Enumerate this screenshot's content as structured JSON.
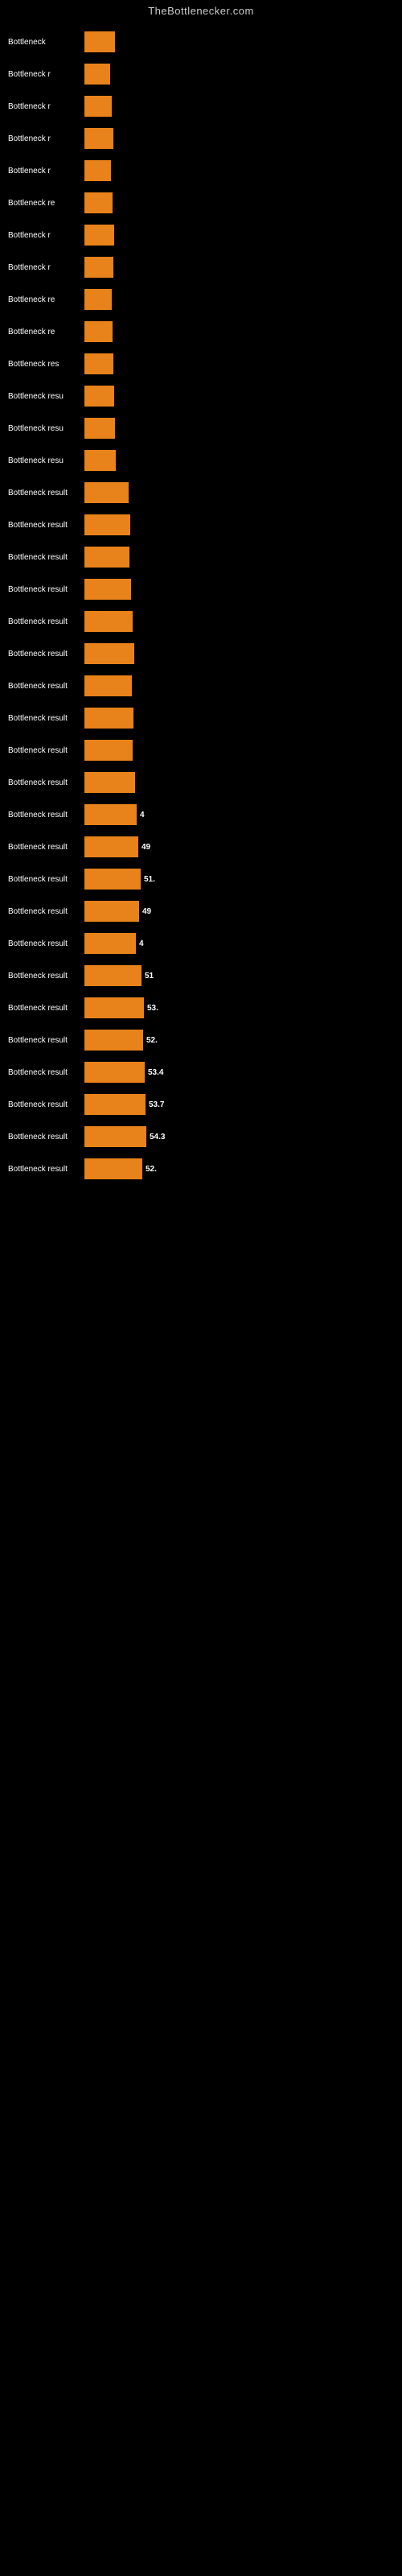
{
  "site": {
    "title": "TheBottlenecker.com"
  },
  "bars": [
    {
      "label": "Bottleneck",
      "width": 38,
      "value": "",
      "outside": false
    },
    {
      "label": "Bottleneck r",
      "width": 32,
      "value": "",
      "outside": false
    },
    {
      "label": "Bottleneck r",
      "width": 34,
      "value": "",
      "outside": false
    },
    {
      "label": "Bottleneck r",
      "width": 36,
      "value": "",
      "outside": false
    },
    {
      "label": "Bottleneck r",
      "width": 33,
      "value": "",
      "outside": false
    },
    {
      "label": "Bottleneck re",
      "width": 35,
      "value": "",
      "outside": false
    },
    {
      "label": "Bottleneck r",
      "width": 37,
      "value": "",
      "outside": false
    },
    {
      "label": "Bottleneck r",
      "width": 36,
      "value": "",
      "outside": false
    },
    {
      "label": "Bottleneck re",
      "width": 34,
      "value": "",
      "outside": false
    },
    {
      "label": "Bottleneck re",
      "width": 35,
      "value": "",
      "outside": false
    },
    {
      "label": "Bottleneck res",
      "width": 36,
      "value": "",
      "outside": false
    },
    {
      "label": "Bottleneck resu",
      "width": 37,
      "value": "",
      "outside": false
    },
    {
      "label": "Bottleneck resu",
      "width": 38,
      "value": "",
      "outside": false
    },
    {
      "label": "Bottleneck resu",
      "width": 39,
      "value": "",
      "outside": false
    },
    {
      "label": "Bottleneck result",
      "width": 55,
      "value": "",
      "outside": false
    },
    {
      "label": "Bottleneck result",
      "width": 57,
      "value": "",
      "outside": false
    },
    {
      "label": "Bottleneck result",
      "width": 56,
      "value": "",
      "outside": false
    },
    {
      "label": "Bottleneck result",
      "width": 58,
      "value": "",
      "outside": false
    },
    {
      "label": "Bottleneck result",
      "width": 60,
      "value": "",
      "outside": false
    },
    {
      "label": "Bottleneck result",
      "width": 62,
      "value": "",
      "outside": false
    },
    {
      "label": "Bottleneck result",
      "width": 59,
      "value": "",
      "outside": false
    },
    {
      "label": "Bottleneck result",
      "width": 61,
      "value": "",
      "outside": false
    },
    {
      "label": "Bottleneck result",
      "width": 60,
      "value": "",
      "outside": false
    },
    {
      "label": "Bottleneck result",
      "width": 63,
      "value": "",
      "outside": false
    },
    {
      "label": "Bottleneck result",
      "width": 65,
      "value": "4",
      "outside": true
    },
    {
      "label": "Bottleneck result",
      "width": 67,
      "value": "49",
      "outside": true
    },
    {
      "label": "Bottleneck result",
      "width": 70,
      "value": "51.",
      "outside": true
    },
    {
      "label": "Bottleneck result",
      "width": 68,
      "value": "49",
      "outside": true
    },
    {
      "label": "Bottleneck result",
      "width": 64,
      "value": "4",
      "outside": true
    },
    {
      "label": "Bottleneck result",
      "width": 71,
      "value": "51",
      "outside": true
    },
    {
      "label": "Bottleneck result",
      "width": 74,
      "value": "53.",
      "outside": true
    },
    {
      "label": "Bottleneck result",
      "width": 73,
      "value": "52.",
      "outside": true
    },
    {
      "label": "Bottleneck result",
      "width": 75,
      "value": "53.4",
      "outside": true
    },
    {
      "label": "Bottleneck result",
      "width": 76,
      "value": "53.7",
      "outside": true
    },
    {
      "label": "Bottleneck result",
      "width": 77,
      "value": "54.3",
      "outside": true
    },
    {
      "label": "Bottleneck result",
      "width": 72,
      "value": "52.",
      "outside": true
    }
  ]
}
